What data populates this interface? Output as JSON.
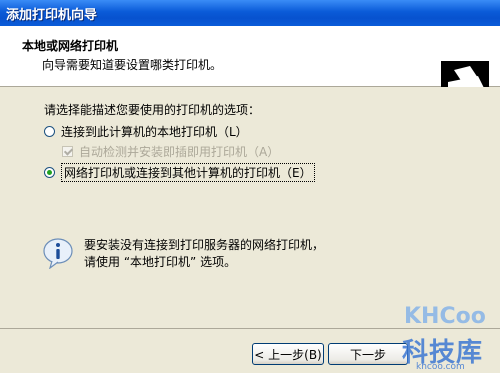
{
  "window": {
    "title": "添加打印机向导"
  },
  "header": {
    "title": "本地或网络打印机",
    "subtitle": "向导需要知道要设置哪类打印机。",
    "icon": "printer-icon"
  },
  "main": {
    "prompt": "请选择能描述您要使用的打印机的选项：",
    "options": [
      {
        "label": "连接到此计算机的本地打印机（L）",
        "checked": false
      },
      {
        "label": "自动检测并安装即插即用打印机（A）",
        "checked": true,
        "disabled": true
      },
      {
        "label": "网络打印机或连接到其他计算机的打印机（E）",
        "checked": true
      }
    ],
    "info_icon": "info-icon",
    "info_lines": [
      "要安装没有连接到打印服务器的网络打印机，",
      "请使用 “本地打印机” 选项。"
    ]
  },
  "footer": {
    "back_label": "< 上一步(B)",
    "next_label": "下一步"
  },
  "watermark": {
    "logo": "KHCoo",
    "brand": "科技库",
    "url": "khcoo.com"
  }
}
